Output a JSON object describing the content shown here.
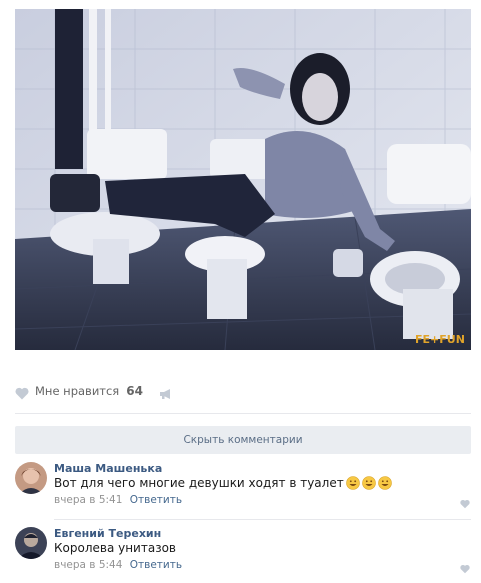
{
  "post": {
    "photo": {
      "icon": "photo-image",
      "watermark": "FE+FUN"
    },
    "likes": {
      "label": "Мне нравится",
      "count": "64",
      "heart_icon": "heart-icon",
      "share_icon": "megaphone-icon"
    },
    "hide_comments_label": "Скрыть комментарии"
  },
  "comments": [
    {
      "author": "Маша Машенька",
      "text": "Вот для чего многие девушки ходят в туалет",
      "emojis": [
        "smile-emoji",
        "smile-emoji",
        "smile-emoji"
      ],
      "time": "вчера в 5:41",
      "reply_label": "Ответить"
    },
    {
      "author": "Евгений Терехин",
      "text": "Королева унитазов",
      "time": "вчера в 5:44",
      "reply_label": "Ответить"
    }
  ],
  "colors": {
    "link": "#45688e",
    "author": "#3c5a82",
    "muted": "#939393",
    "bar": "#eaedf1"
  }
}
